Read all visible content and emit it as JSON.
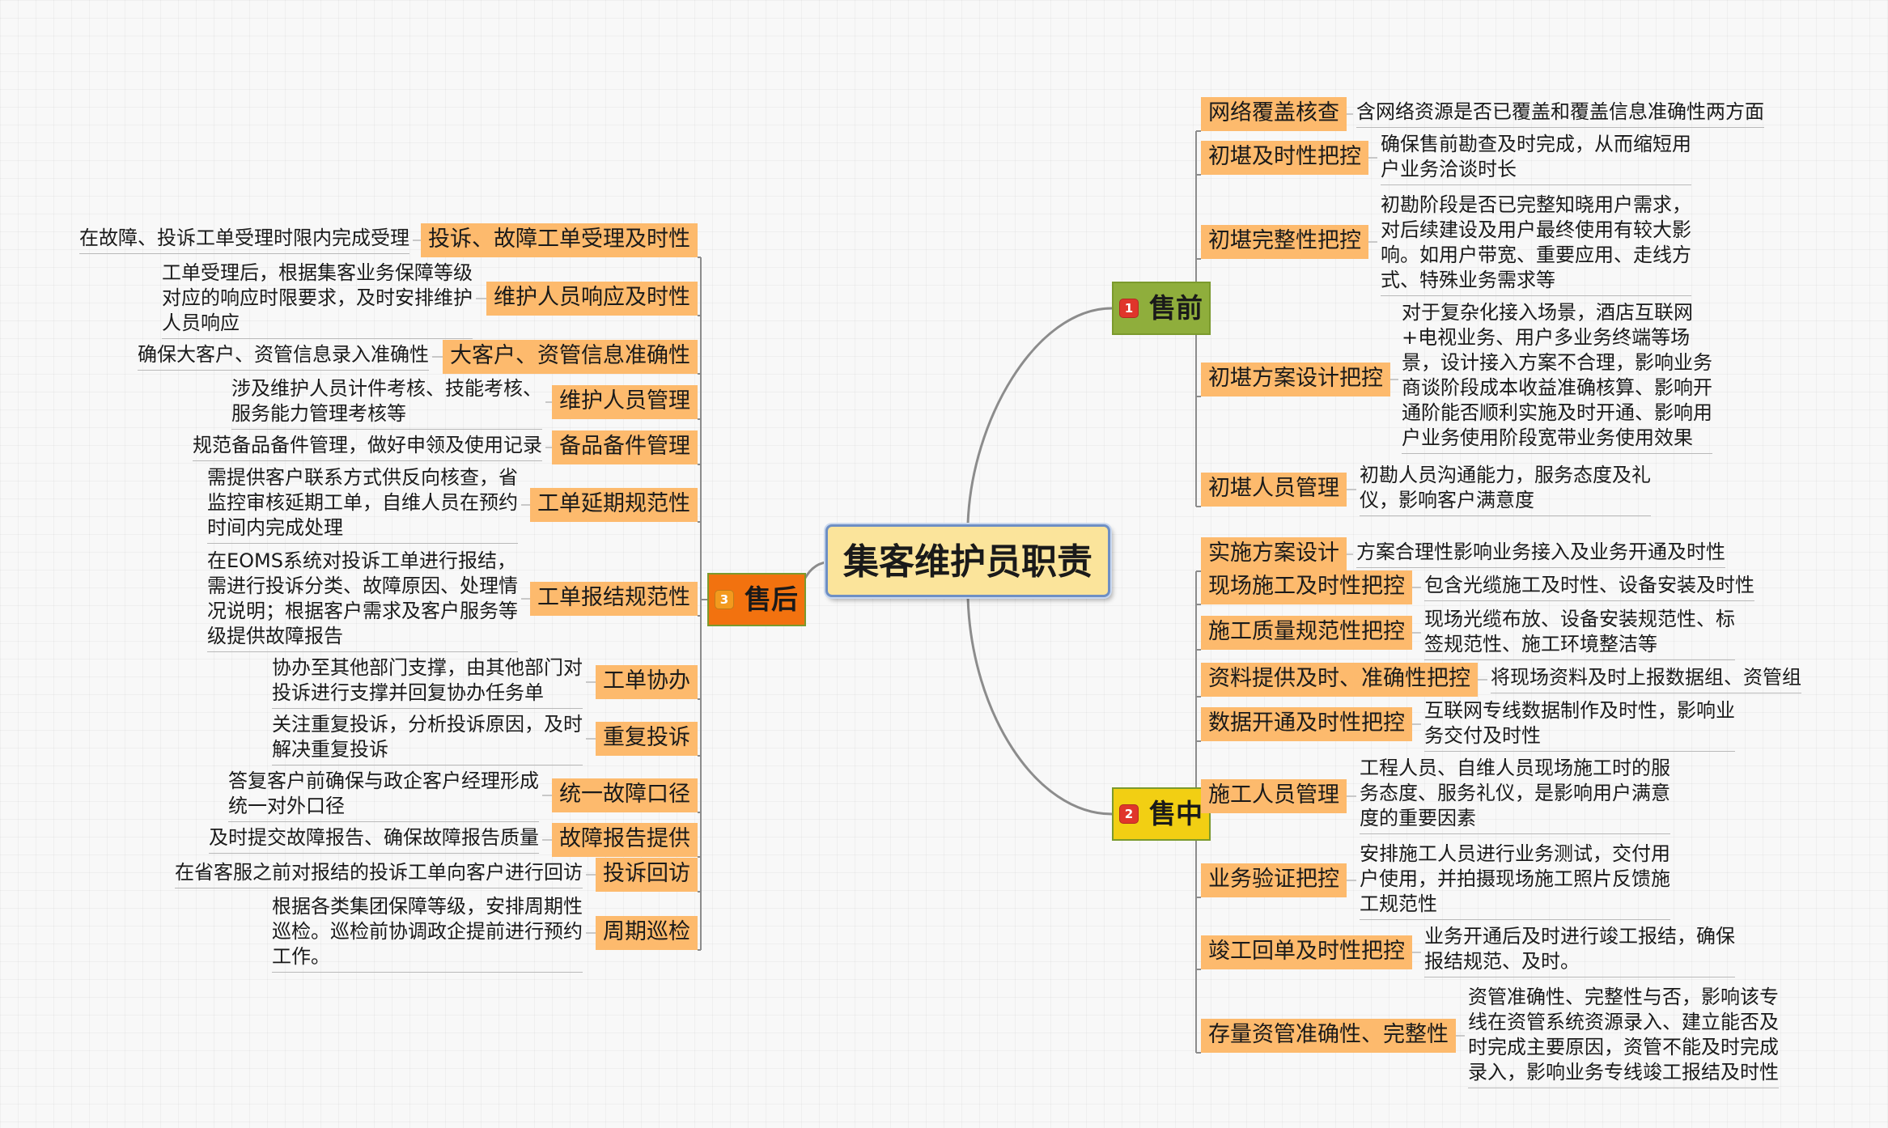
{
  "center": {
    "title": "集客维护员职责"
  },
  "branches": {
    "presale": {
      "label": "售前",
      "badge": "1",
      "items": [
        {
          "topic": "网络覆盖核查",
          "note": "含网络资源是否已覆盖和覆盖信息准确性两方面"
        },
        {
          "topic": "初堪及时性把控",
          "note": "确保售前勘查及时完成，从而缩短用\n户业务洽谈时长"
        },
        {
          "topic": "初堪完整性把控",
          "note": "初勘阶段是否已完整知晓用户需求，\n对后续建设及用户最终使用有较大影\n响。如用户带宽、重要应用、走线方\n式、特殊业务需求等"
        },
        {
          "topic": "初堪方案设计把控",
          "note": "对于复杂化接入场景，酒店互联网\n+电视业务、用户多业务终端等场\n景，设计接入方案不合理，影响业务\n商谈阶段成本收益准确核算、影响开\n通阶能否顺利实施及时开通、影响用\n户业务使用阶段宽带业务使用效果"
        },
        {
          "topic": "初堪人员管理",
          "note": "初勘人员沟通能力，服务态度及礼\n仪，影响客户满意度"
        }
      ]
    },
    "insale": {
      "label": "售中",
      "badge": "2",
      "items": [
        {
          "topic": "实施方案设计",
          "note": "方案合理性影响业务接入及业务开通及时性"
        },
        {
          "topic": "现场施工及时性把控",
          "note": "包含光缆施工及时性、设备安装及时性"
        },
        {
          "topic": "施工质量规范性把控",
          "note": "现场光缆布放、设备安装规范性、标\n签规范性、施工环境整洁等"
        },
        {
          "topic": "资料提供及时、准确性把控",
          "note": "将现场资料及时上报数据组、资管组"
        },
        {
          "topic": "数据开通及时性把控",
          "note": "互联网专线数据制作及时性，影响业\n务交付及时性"
        },
        {
          "topic": "施工人员管理",
          "note": "工程人员、自维人员现场施工时的服\n务态度、服务礼仪，是影响用户满意\n度的重要因素"
        },
        {
          "topic": "业务验证把控",
          "note": "安排施工人员进行业务测试，交付用\n户使用，并拍摄现场施工照片反馈施\n工规范性"
        },
        {
          "topic": "竣工回单及时性把控",
          "note": "业务开通后及时进行竣工报结，确保\n报结规范、及时。"
        },
        {
          "topic": "存量资管准确性、完整性",
          "note": "资管准确性、完整性与否，影响该专\n线在资管系统资源录入、建立能否及\n时完成主要原因，资管不能及时完成\n录入，影响业务专线竣工报结及时性"
        }
      ]
    },
    "aftersale": {
      "label": "售后",
      "badge": "3",
      "items": [
        {
          "topic": "投诉、故障工单受理及时性",
          "note": "在故障、投诉工单受理时限内完成受理"
        },
        {
          "topic": "维护人员响应及时性",
          "note": "工单受理后，根据集客业务保障等级\n对应的响应时限要求，及时安排维护\n人员响应"
        },
        {
          "topic": "大客户、资管信息准确性",
          "note": "确保大客户、资管信息录入准确性"
        },
        {
          "topic": "维护人员管理",
          "note": "涉及维护人员计件考核、技能考核、\n服务能力管理考核等"
        },
        {
          "topic": "备品备件管理",
          "note": "规范备品备件管理，做好申领及使用记录"
        },
        {
          "topic": "工单延期规范性",
          "note": "需提供客户联系方式供反向核查，省\n监控审核延期工单，自维人员在预约\n时间内完成处理"
        },
        {
          "topic": "工单报结规范性",
          "note": "在EOMS系统对投诉工单进行报结，\n需进行投诉分类、故障原因、处理情\n况说明；根据客户需求及客户服务等\n级提供故障报告"
        },
        {
          "topic": "工单协办",
          "note": "协办至其他部门支撑，由其他部门对\n投诉进行支撑并回复协办任务单"
        },
        {
          "topic": "重复投诉",
          "note": "关注重复投诉，分析投诉原因，及时\n解决重复投诉"
        },
        {
          "topic": "统一故障口径",
          "note": "答复客户前确保与政企客户经理形成\n统一对外口径"
        },
        {
          "topic": "故障报告提供",
          "note": "及时提交故障报告、确保故障报告质量"
        },
        {
          "topic": "投诉回访",
          "note": "在省客服之前对报结的投诉工单向客户进行回访"
        },
        {
          "topic": "周期巡检",
          "note": "根据各类集团保障等级，安排周期性\n巡检。巡检前协调政企提前进行预约\n 工作。"
        }
      ]
    }
  },
  "colors": {
    "presale": "#8fae3c",
    "insale": "#f2cf13",
    "aftersale": "#f2720f",
    "topic": "#fdba6d",
    "line": "#8c8c8c"
  }
}
